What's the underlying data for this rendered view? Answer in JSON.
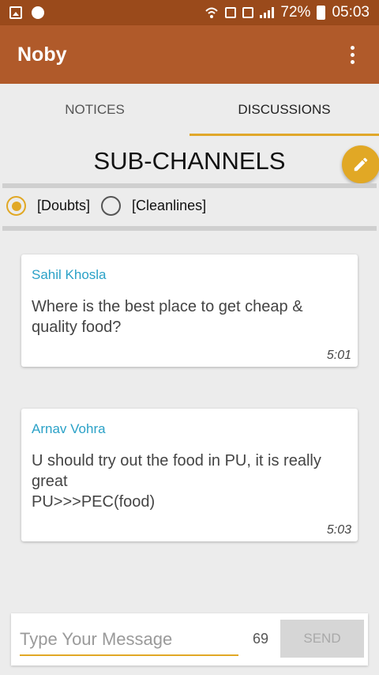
{
  "status_bar": {
    "battery": "72%",
    "time": "05:03",
    "icons": [
      "gallery-icon",
      "whatsapp-icon",
      "wifi-calling-icon",
      "phone-icon",
      "sim-signal-icon",
      "signal-bars-icon",
      "battery-icon"
    ]
  },
  "app_bar": {
    "title": "Noby",
    "menu_icon": "overflow-menu-icon"
  },
  "tabs": [
    {
      "label": "NOTICES",
      "active": false
    },
    {
      "label": "DISCUSSIONS",
      "active": true
    }
  ],
  "section_title": "SUB-CHANNELS",
  "fab_icon": "edit-pencil-icon",
  "channels": [
    {
      "label": "[Doubts]",
      "selected": true
    },
    {
      "label": "[Cleanlines]",
      "selected": false
    }
  ],
  "messages": [
    {
      "author": "Sahil Khosla",
      "text": "Where is the best place to get cheap & quality food?",
      "time": "5:01"
    },
    {
      "author": "Arnav Vohra",
      "text": "U should try out the food in PU, it is really great\nPU>>>PEC(food)",
      "time": "5:03"
    }
  ],
  "compose": {
    "placeholder": "Type Your Message",
    "value": "",
    "char_count": "69",
    "send_label": "SEND"
  },
  "colors": {
    "status_bar": "#9a4a1b",
    "app_bar": "#b05a2a",
    "accent": "#e1a825",
    "author": "#2aa1c7"
  }
}
